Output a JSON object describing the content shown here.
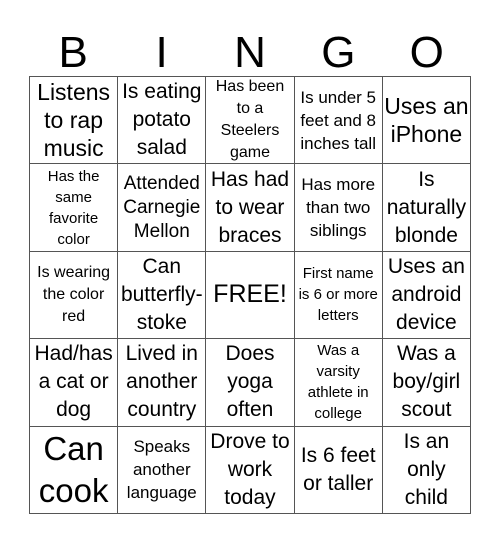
{
  "header": {
    "letters": [
      "B",
      "I",
      "N",
      "G",
      "O"
    ]
  },
  "cells": [
    [
      "Listens to rap music",
      "Is eating potato salad",
      "Has been to a Steelers game",
      "Is under 5 feet and 8 inches tall",
      "Uses an iPhone"
    ],
    [
      "Has the same favorite color",
      "Attended Carnegie Mellon",
      "Has had to wear braces",
      "Has more than two siblings",
      "Is naturally blonde"
    ],
    [
      "Is wearing the color red",
      "Can butterfly-stoke",
      "FREE!",
      "First name is 6 or more letters",
      "Uses an android device"
    ],
    [
      "Had/has a cat or dog",
      "Lived in another country",
      "Does yoga often",
      "Was a varsity athlete in college",
      "Was a boy/girl scout"
    ],
    [
      "Can cook",
      "Speaks another language",
      "Drove to work today",
      "Is 6 feet or taller",
      "Is an only child"
    ]
  ]
}
